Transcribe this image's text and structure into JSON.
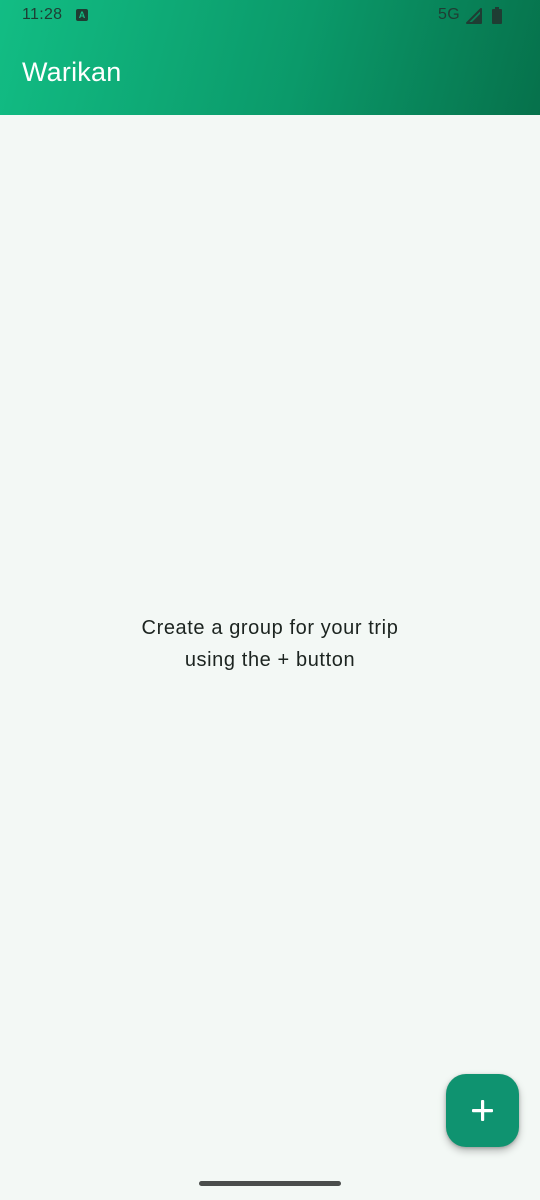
{
  "status_bar": {
    "time": "11:28",
    "notification_icon": "a-icon",
    "network": "5G",
    "signal_icon": "signal-icon",
    "battery_icon": "battery-icon"
  },
  "app_bar": {
    "title": "Warikan",
    "colors": {
      "gradient_start": "#12bd84",
      "gradient_end": "#06714b"
    }
  },
  "main": {
    "empty_message": "Create a group for your trip\nusing the + button"
  },
  "fab": {
    "icon": "plus-icon",
    "color": "#0f9370"
  }
}
